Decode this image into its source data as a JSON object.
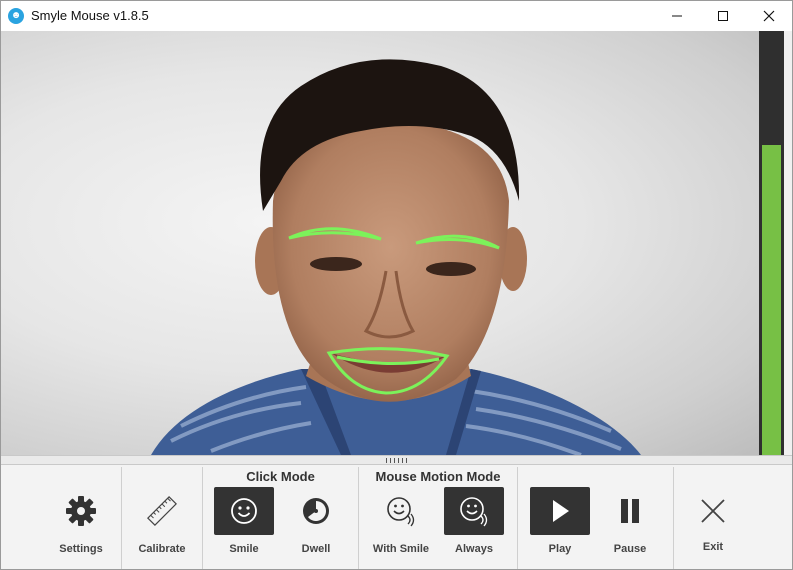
{
  "window": {
    "title": "Smyle Mouse v1.8.5",
    "app_icon_glyph": "☻",
    "buttons": [
      "minimize-icon",
      "maximize-icon",
      "close-icon"
    ]
  },
  "camera": {
    "description_icon": "webcam-face-feed",
    "level_meter_fraction": 0.73,
    "colors": {
      "tracking": "#7cf25a",
      "meter": "#77c045"
    }
  },
  "toolbar": {
    "settings_label": "Settings",
    "calibrate_label": "Calibrate",
    "click_mode": {
      "title": "Click Mode",
      "smile_label": "Smile",
      "dwell_label": "Dwell",
      "selected": "Smile"
    },
    "motion_mode": {
      "title": "Mouse Motion Mode",
      "with_smile_label": "With Smile",
      "always_label": "Always",
      "selected": "Always"
    },
    "play_label": "Play",
    "pause_label": "Pause",
    "exit_label": "Exit",
    "active_play": true
  }
}
